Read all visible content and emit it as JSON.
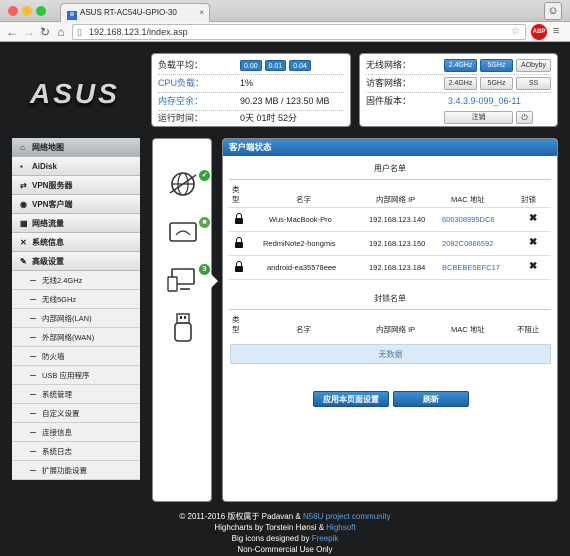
{
  "browser": {
    "tab_title": "ASUS RT-AC54U-GPIO-30",
    "url": "192.168.123.1/index.asp",
    "abp": "ABP"
  },
  "logo": "ASUS",
  "status": {
    "load_label": "负载平均：",
    "load_values": [
      "0.00",
      "0.01",
      "0.04"
    ],
    "cpu_label": "CPU负载：",
    "cpu_value": "1%",
    "mem_label": "内存空余：",
    "mem_value": "90.23 MB / 123.50 MB",
    "uptime_label": "运行时间：",
    "uptime_value": "0天 01时 52分"
  },
  "wireless": {
    "wifi_label": "无线网络：",
    "guest_label": "访客网络：",
    "fw_label": "固件版本：",
    "btn_24": "2.4GHz",
    "btn_5": "5GHz",
    "btn_aoby": "AObyby",
    "btn_g24": "2.4GHz",
    "btn_g5": "5GHz",
    "btn_ss": "SS",
    "fw_value": "3.4.3.9-099_06-11",
    "logout": "注销"
  },
  "sidebar": {
    "items": [
      {
        "icon": "⌂",
        "label": "网络地图"
      },
      {
        "icon": "▪",
        "label": "AiDisk"
      },
      {
        "icon": "⇄",
        "label": "VPN服务器"
      },
      {
        "icon": "◉",
        "label": "VPN客户端"
      },
      {
        "icon": "▦",
        "label": "网络流量"
      },
      {
        "icon": "✕",
        "label": "系统信息"
      },
      {
        "icon": "✎",
        "label": "高级设置"
      }
    ],
    "subitems": [
      "无线2.4GHz",
      "无线5GHz",
      "内部网络(LAN)",
      "外部网络(WAN)",
      "防火墙",
      "USB 应用程序",
      "系统管理",
      "自定义设置",
      "连接信息",
      "系统日志",
      "扩展功能设置"
    ]
  },
  "devices": {
    "badge_check": "✓",
    "badge_count": "3"
  },
  "main": {
    "title": "客户端状态",
    "user_list_title": "用户名单",
    "block_list_title": "封锁名单",
    "col_type": "类型",
    "col_name": "名字",
    "col_ip": "内部网络 IP",
    "col_mac": "MAC 地址",
    "col_block": "封锁",
    "col_unblock": "不阻止",
    "clients": [
      {
        "name": "Wus-MacBook-Pro",
        "ip": "192.168.123.140",
        "mac": "600308995DC6"
      },
      {
        "name": "RedmiNote2-hongmis",
        "ip": "192.168.123.150",
        "mac": "2082C0866592"
      },
      {
        "name": "android-ea35578eee",
        "ip": "192.168.123.184",
        "mac": "BCBEBE5EFC17"
      }
    ],
    "no_data": "无数据",
    "apply_btn": "应用本页面设置",
    "refresh_btn": "刷新"
  },
  "footer": {
    "line1_a": "© 2011-2016 版权属于 Padavan &",
    "line1_b": "N56U project community",
    "line2_a": "Highcharts by Torstein Hønsi &",
    "line2_b": "Highsoft",
    "line3_a": "Big icons designed by",
    "line3_b": "Freepik",
    "line4": "Non-Commercial Use Only"
  }
}
